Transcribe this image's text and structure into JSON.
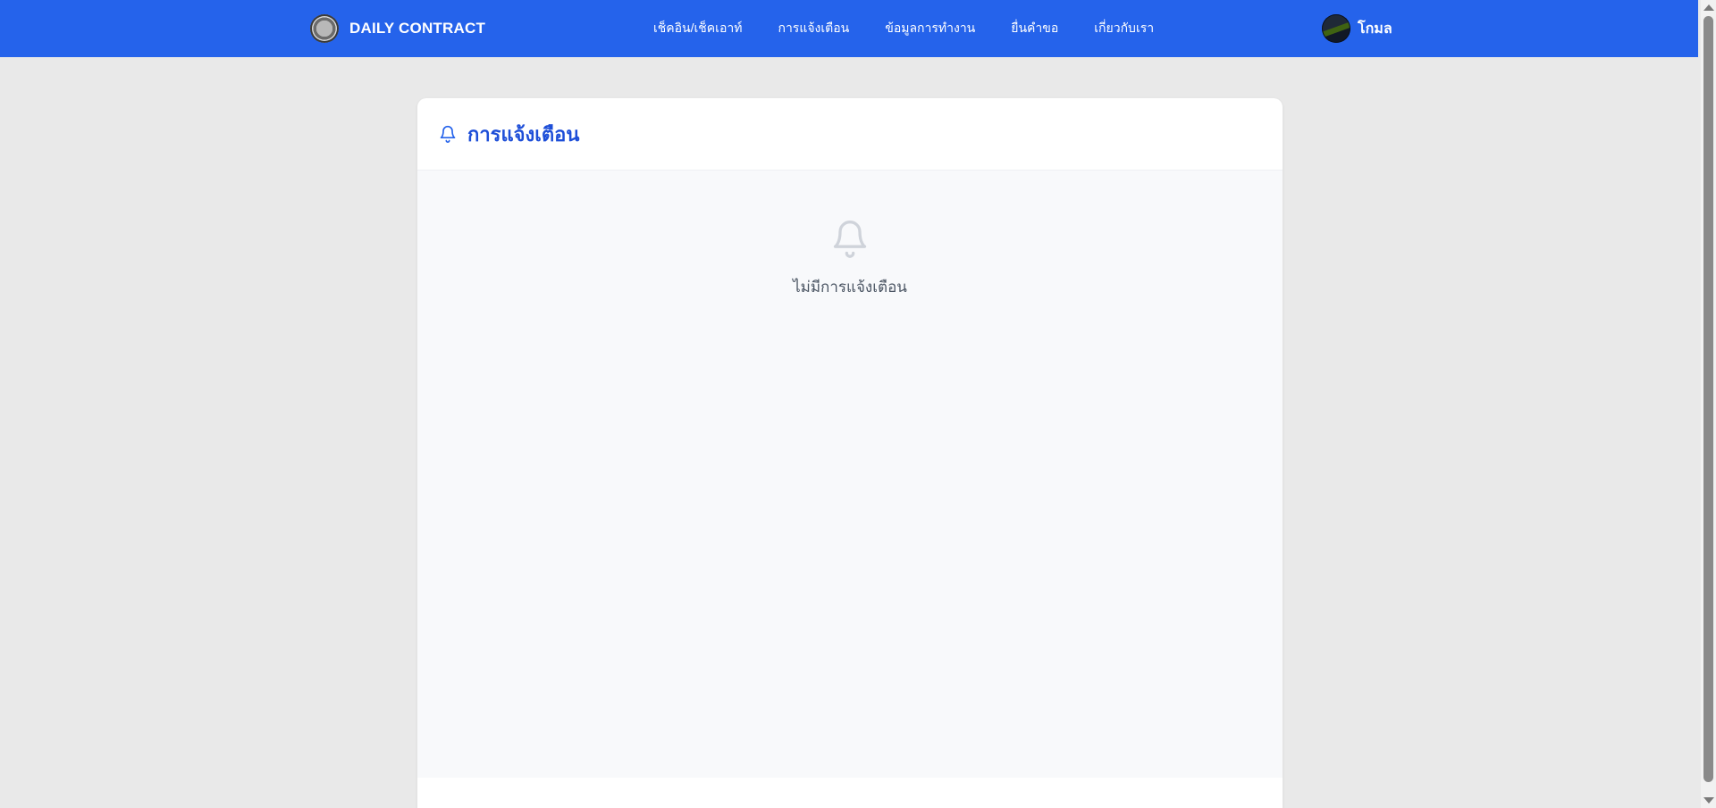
{
  "app": {
    "brand_name": "DAILY CONTRACT",
    "colors": {
      "navbar": "#2563eb",
      "title": "#1d4ed8",
      "page_background": "#e9e9e9",
      "card_body": "#f8f9fb"
    }
  },
  "nav": {
    "items": [
      {
        "label": "เช็คอิน/เช็คเอาท์"
      },
      {
        "label": "การแจ้งเตือน"
      },
      {
        "label": "ข้อมูลการทำงาน"
      },
      {
        "label": "ยื่นคำขอ"
      },
      {
        "label": "เกี่ยวกับเรา"
      }
    ]
  },
  "user": {
    "name": "โกมล",
    "avatar_icon": "user-avatar"
  },
  "card": {
    "title": "การแจ้งเตือน",
    "title_icon": "bell-icon",
    "empty_icon": "bell-icon",
    "empty_message": "ไม่มีการแจ้งเตือน"
  }
}
